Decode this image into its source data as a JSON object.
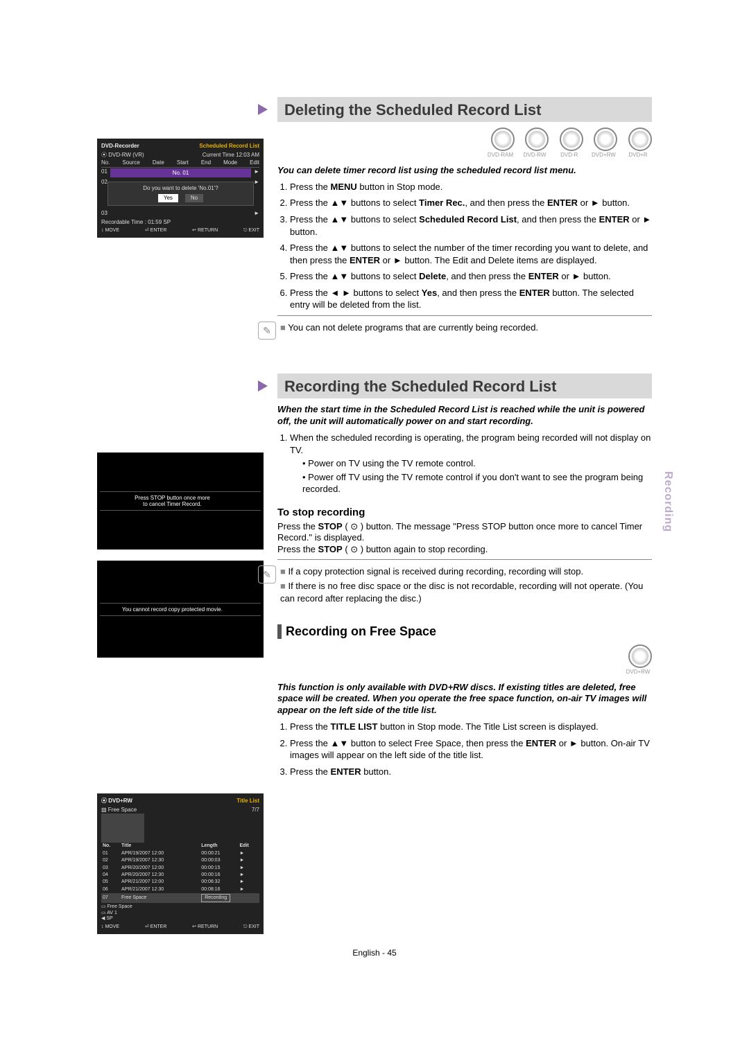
{
  "tab": "Recording",
  "footer": "English - 45",
  "disc_labels": [
    "DVD-RAM",
    "DVD-RW",
    "DVD-R",
    "DVD+RW",
    "DVD+R"
  ],
  "section1": {
    "title": "Deleting the Scheduled Record List",
    "intro": "You can delete timer record list using the scheduled record list menu.",
    "steps": [
      {
        "pre": "Press the ",
        "kw": "MENU",
        "post": " button in Stop mode."
      },
      {
        "pre": "Press the ▲▼ buttons to select ",
        "kw": "Timer Rec.",
        "post": ", and then press the ",
        "kw2": "ENTER",
        "post2": " or ► button."
      },
      {
        "pre": "Press the ▲▼ buttons to select ",
        "kw": "Scheduled Record List",
        "post": ", and then press the ",
        "kw2": "ENTER",
        "post2": " or ► button."
      },
      {
        "pre": "Press the ▲▼ buttons to select the number of the timer recording you want to delete, and then press the ",
        "kw": "ENTER",
        "post": " or ► button. The Edit and Delete items are displayed."
      },
      {
        "pre": "Press the ▲▼ buttons to select ",
        "kw": "Delete",
        "post": ", and then press the ",
        "kw2": "ENTER",
        "post2": " or ► button."
      },
      {
        "pre": "Press the ◄ ► buttons to select ",
        "kw": "Yes",
        "post": ", and then press the ",
        "kw2": "ENTER",
        "post2": " button. The selected entry will be deleted from the list."
      }
    ],
    "note": "You can not delete programs that are currently being recorded."
  },
  "section2": {
    "title": "Recording the Scheduled Record List",
    "intro": "When the start time in the Scheduled Record List is reached while the unit is powered off, the unit will automatically power on and start recording.",
    "step1": "When the scheduled recording is operating, the program being recorded will not display on TV.",
    "step1_dots": [
      "Power on TV using the TV remote control.",
      "Power off TV using the TV remote control if you don't want to see the program being recorded."
    ],
    "sub": "To stop recording",
    "sub_p1a": "Press the ",
    "sub_p1kw": "STOP",
    "sub_p1b": " ( ⊙ ) button. The message \"Press STOP button once more to cancel Timer Record.\" is displayed.",
    "sub_p2a": "Press the ",
    "sub_p2kw": "STOP",
    "sub_p2b": " ( ⊙ ) button again to stop recording.",
    "notes": [
      "If a copy protection signal is received during recording, recording will stop.",
      "If there is no free disc space or the disc is not recordable, recording will not operate. (You can record after replacing the disc.)"
    ]
  },
  "section3": {
    "sub": "Recording on Free Space",
    "disc": "DVD+RW",
    "intro": "This function is only available with DVD+RW discs. If existing titles are deleted, free space will be created. When you operate the free space function, on-air TV images will appear on the left side of the title list.",
    "steps": [
      {
        "pre": "Press the ",
        "kw": "TITLE LIST",
        "post": " button in Stop mode. The Title List screen is displayed."
      },
      {
        "pre": "Press the ▲▼ button to select Free Space, then press the ",
        "kw": "ENTER",
        "post": " or ► button. On-air TV images will appear on the left side of the title list."
      },
      {
        "pre": "Press the ",
        "kw": "ENTER",
        "post": " button."
      }
    ]
  },
  "mock1": {
    "recorder": "DVD-Recorder",
    "listname": "Scheduled Record List",
    "disc": "DVD-RW (VR)",
    "time_lbl": "Current Time",
    "time_val": "12:03 AM",
    "columns": [
      "No.",
      "Source",
      "Date",
      "Start",
      "End",
      "Mode",
      "Edit"
    ],
    "rows": [
      "01",
      "02",
      "03"
    ],
    "sel": "No. 01",
    "dialog": "Do you want to delete 'No.01'?",
    "yes": "Yes",
    "no": "No",
    "rectime": "Recordable Time : 01:59  SP",
    "footer": [
      "↕ MOVE",
      "⏎ ENTER",
      "↩ RETURN",
      "⎋ EXIT"
    ]
  },
  "mock2": {
    "msg": "Press STOP button once more\nto cancel Timer Record."
  },
  "mock3": {
    "msg": "You cannot record copy protected movie."
  },
  "mock4": {
    "disc": "DVD+RW",
    "listname": "Title List",
    "sub": "Free Space",
    "count": "7/7",
    "cols": [
      "No.",
      "Title",
      "Length",
      "Edit"
    ],
    "rows": [
      [
        "01",
        "APR/19/2007  12:00",
        "00:00:21",
        "►"
      ],
      [
        "02",
        "APR/19/2007  12:30",
        "00:00:03",
        "►"
      ],
      [
        "03",
        "APR/20/2007  12:00",
        "00:00:15",
        "►"
      ],
      [
        "04",
        "APR/20/2007  12:30",
        "00:00:16",
        "►"
      ],
      [
        "05",
        "APR/21/2007  12:00",
        "00:06:32",
        "►"
      ],
      [
        "06",
        "APR/21/2007  12:30",
        "00:08:16",
        "►"
      ]
    ],
    "freerow": [
      "07",
      "Free Space",
      "Recording"
    ],
    "meta1": "Free Space",
    "meta2": "AV 1",
    "meta3": "SP",
    "footer": [
      "↕ MOVE",
      "⏎ ENTER",
      "↩ RETURN",
      "⎋ EXIT"
    ]
  }
}
